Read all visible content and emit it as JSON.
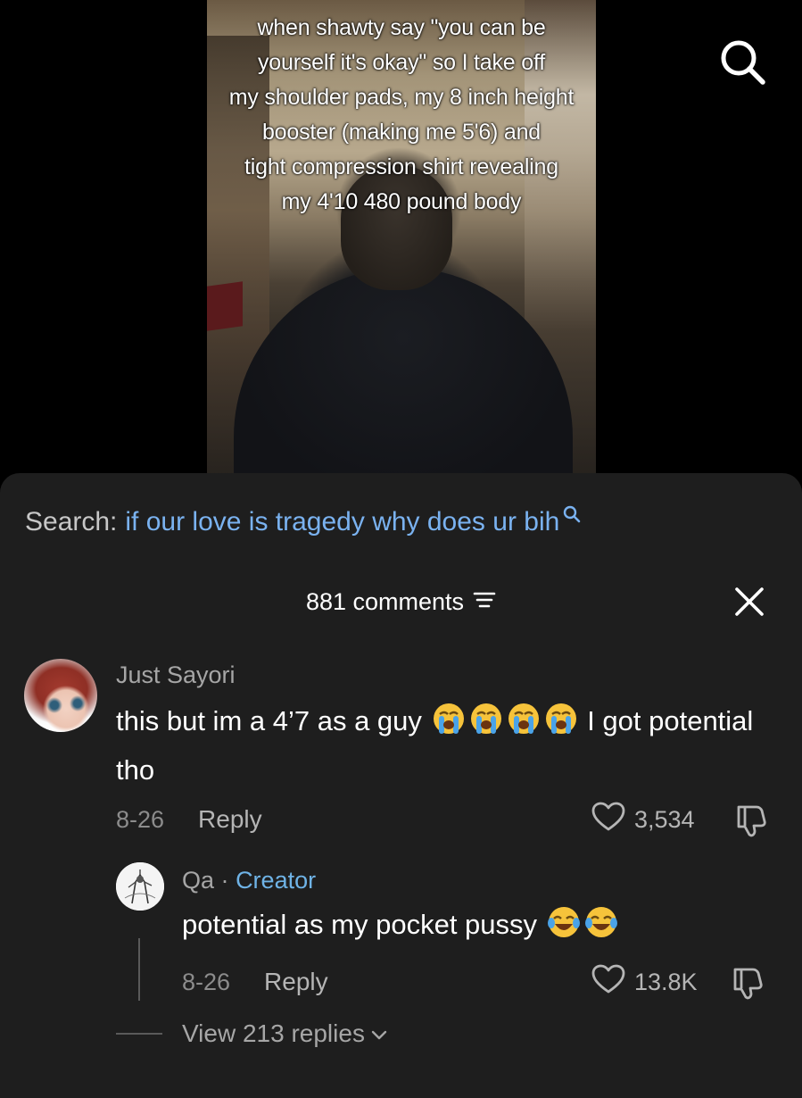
{
  "video": {
    "caption_lines": [
      "when shawty say \"you can be",
      "yourself it's okay\" so I take off",
      "my shoulder pads, my 8 inch height",
      "booster (making me 5'6) and",
      "tight compression shirt revealing",
      "my 4'10 480 pound body"
    ],
    "search_icon": "search-icon"
  },
  "search_suggestion": {
    "prefix": "Search:",
    "query": "if our love is tragedy why does ur bih"
  },
  "comments_header": {
    "count_label": "881 comments",
    "sort_icon": "sort-icon",
    "close_icon": "close-icon"
  },
  "comment": {
    "username": "Just Sayori",
    "text_before_emoji": "this but im a 4’7 as a guy",
    "emoji": [
      "loudly-crying-face",
      "loudly-crying-face",
      "loudly-crying-face",
      "loudly-crying-face"
    ],
    "text_after_emoji": "I got potential tho",
    "date": "8-26",
    "reply_label": "Reply",
    "likes": "3,534"
  },
  "reply": {
    "username": "Qa",
    "separator": "·",
    "badge": "Creator",
    "text": "potential as my pocket pussy",
    "emoji": [
      "face-with-tears-of-joy",
      "face-with-tears-of-joy"
    ],
    "date": "8-26",
    "reply_label": "Reply",
    "likes": "13.8K"
  },
  "view_replies": {
    "label": "View 213 replies"
  },
  "colors": {
    "sheet_bg": "#1e1e1e",
    "search_query": "#7ab2f0",
    "creator_badge": "#6fb3e6",
    "muted_text": "#a6a6a6"
  }
}
